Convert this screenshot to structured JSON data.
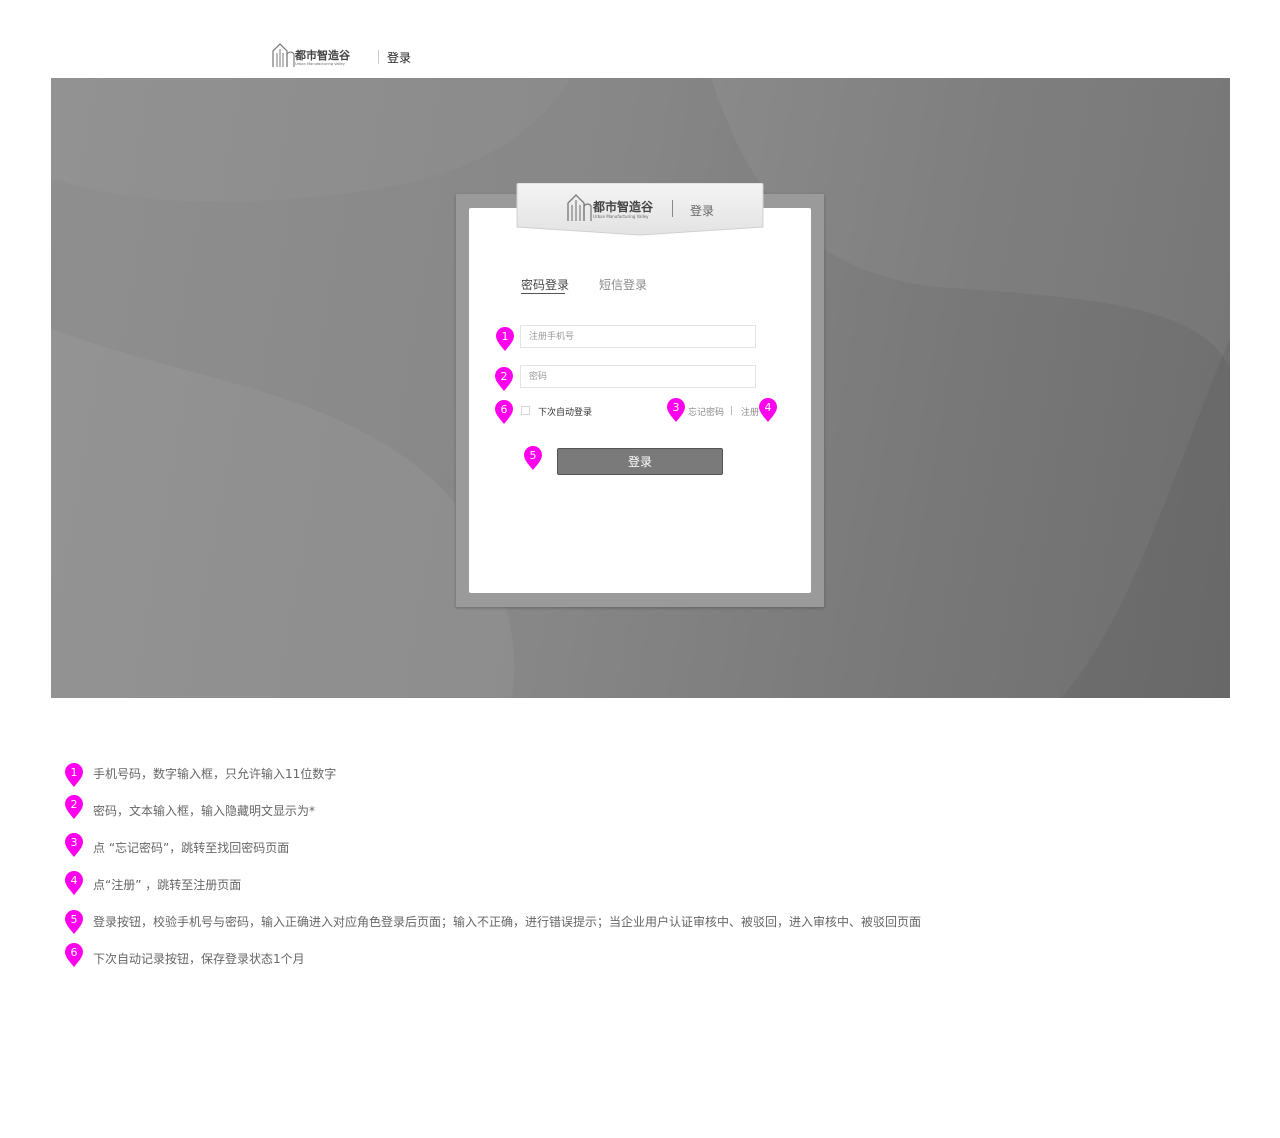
{
  "header": {
    "brand_cn": "都市智造谷",
    "brand_en": "Urban Manufacturing Valley",
    "title": "登录"
  },
  "card": {
    "brand_cn": "都市智造谷",
    "brand_en": "Urban Manufacturing Valley",
    "title": "登录",
    "tabs": [
      {
        "label": "密码登录",
        "active": true
      },
      {
        "label": "短信登录",
        "active": false
      }
    ],
    "phone_placeholder": "注册手机号",
    "password_placeholder": "密码",
    "remember_label": "下次自动登录",
    "forgot_label": "忘记密码",
    "register_label": "注册",
    "submit_label": "登录"
  },
  "markers": [
    "1",
    "2",
    "3",
    "4",
    "5",
    "6"
  ],
  "notes": [
    {
      "num": "1",
      "text": "手机号码，数字输入框，只允许输入11位数字"
    },
    {
      "num": "2",
      "text": "密码，文本输入框，输入隐藏明文显示为*"
    },
    {
      "num": "3",
      "text": "点 “忘记密码”，跳转至找回密码页面"
    },
    {
      "num": "4",
      "text": "点“注册” ，跳转至注册页面"
    },
    {
      "num": "5",
      "text": "登录按钮，校验手机号与密码，输入正确进入对应角色登录后页面；输入不正确，进行错误提示；当企业用户认证审核中、被驳回，进入审核中、被驳回页面"
    },
    {
      "num": "6",
      "text": "下次自动记录按钮，保存登录状态1个月"
    }
  ],
  "colors": {
    "marker": "#ff00ee",
    "hero_bg": "#858585",
    "button": "#7a7a7a"
  }
}
